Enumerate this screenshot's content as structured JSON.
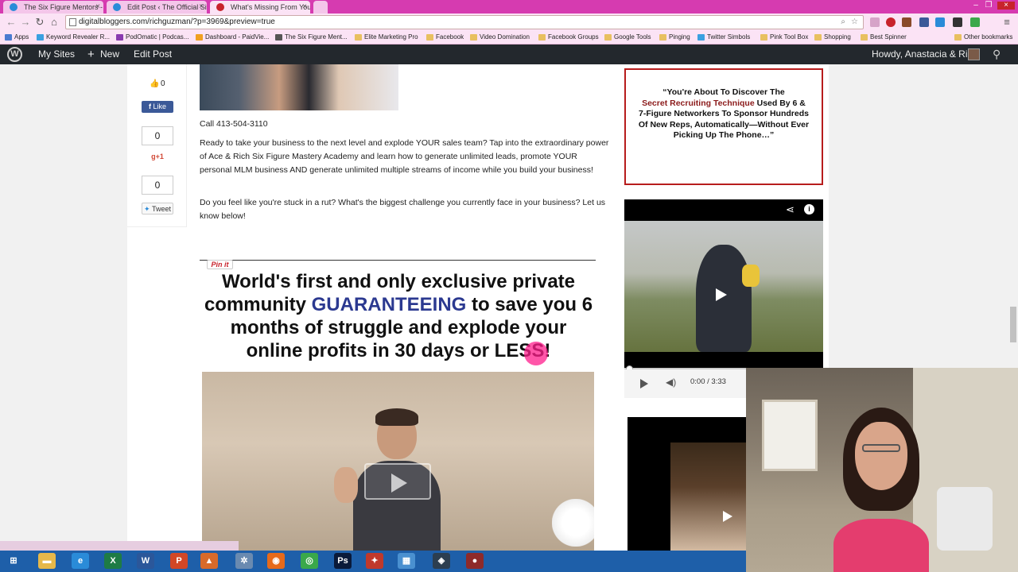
{
  "tabs": [
    {
      "title": "The Six Figure Mentors - T",
      "color": "#2a8bd8"
    },
    {
      "title": "Edit Post ‹ The Official Site",
      "color": "#2a8bd8"
    },
    {
      "title": "What's Missing From You",
      "color": "#c8232c"
    }
  ],
  "address_bar": {
    "url": "digitalbloggers.com/richguzman/?p=3969&preview=true"
  },
  "bookmarks": [
    {
      "label": "Apps",
      "color": "#4a7bd0"
    },
    {
      "label": "Keyword Revealer R...",
      "color": "#3aa0e0"
    },
    {
      "label": "PodOmatic | Podcas...",
      "color": "#8a3ab0"
    },
    {
      "label": "Dashboard - PaidVie...",
      "color": "#f0a020"
    },
    {
      "label": "The Six Figure Ment...",
      "color": "#555555"
    },
    {
      "label": "Elite Marketing Pro",
      "color": "#e8c060"
    },
    {
      "label": "Facebook",
      "color": "#e8c060"
    },
    {
      "label": "Video Domination",
      "color": "#e8c060"
    },
    {
      "label": "Facebook Groups",
      "color": "#e8c060"
    },
    {
      "label": "Google Tools",
      "color": "#e8c060"
    },
    {
      "label": "Pinging",
      "color": "#e8c060"
    },
    {
      "label": "Twitter Simbols",
      "color": "#3aa0e0"
    },
    {
      "label": "Pink Tool Box",
      "color": "#e8c060"
    },
    {
      "label": "Shopping",
      "color": "#e8c060"
    },
    {
      "label": "Best Spinner",
      "color": "#e8c060"
    },
    {
      "label": "Other bookmarks",
      "color": "#e8c060"
    }
  ],
  "admin_bar": {
    "my_sites": "My Sites",
    "new": "New",
    "edit_post": "Edit Post",
    "howdy": "Howdy, Anastacia & Rich"
  },
  "share": {
    "like_count": "0",
    "like_label": "Like",
    "gplus_count": "0",
    "gplus_label": "+1",
    "tweet_count": "0",
    "tweet_label": "Tweet"
  },
  "post": {
    "phone": "Call 413-504-3110",
    "paragraph1": "Ready to take your business to the next level and explode YOUR sales team? Tap into the extraordinary power of Ace & Rich Six Figure Mastery Academy and learn how to generate unlimited leads, promote YOUR personal MLM business AND generate unlimited multiple streams of income while you build your business!",
    "paragraph2": "Do you feel like you're stuck in a rut? What's the biggest challenge you currently face in your business? Let us know below!",
    "pinit": "Pin it",
    "headline_a": "World's first and only exclusive private community ",
    "headline_hl": "GUARANTEEING",
    "headline_b": " to save you 6 months of struggle and explode your online profits in 30 days or LESS!"
  },
  "sidebar": {
    "ad_line1": "“You're About To Discover The",
    "ad_red": "Secret Recruiting Technique",
    "ad_line2": " Used By 6 & 7-Figure Networkers To Sponsor Hundreds Of New Reps, Automatically—Without Ever Picking Up The Phone…”",
    "video_time": "0:00 / 3:33"
  },
  "taskbar": {
    "icons": [
      {
        "name": "start",
        "label": "⊞",
        "color": "#1e5fa9"
      },
      {
        "name": "explorer",
        "label": "▬",
        "color": "#e6b84a"
      },
      {
        "name": "ie",
        "label": "e",
        "color": "#2a8bd8"
      },
      {
        "name": "excel",
        "label": "X",
        "color": "#1e7b45"
      },
      {
        "name": "word",
        "label": "W",
        "color": "#2b579a"
      },
      {
        "name": "powerpoint",
        "label": "P",
        "color": "#d24726"
      },
      {
        "name": "app-orange",
        "label": "▲",
        "color": "#d86a2a"
      },
      {
        "name": "app-settings",
        "label": "✲",
        "color": "#6a8ab0"
      },
      {
        "name": "firefox",
        "label": "◉",
        "color": "#e66a1a"
      },
      {
        "name": "chrome",
        "label": "◎",
        "color": "#3aa84a"
      },
      {
        "name": "photoshop",
        "label": "Ps",
        "color": "#0a1a3a"
      },
      {
        "name": "app-tools",
        "label": "✦",
        "color": "#c0392b"
      },
      {
        "name": "app-blue",
        "label": "▦",
        "color": "#4a90d0"
      },
      {
        "name": "app-camera",
        "label": "◈",
        "color": "#2c3e50"
      },
      {
        "name": "app-record",
        "label": "●",
        "color": "#8e2a2a"
      }
    ]
  },
  "colors": {
    "headline_highlight": "#2b3990",
    "ad_border": "#b71c1c",
    "tabbar": "#d63bb0"
  }
}
